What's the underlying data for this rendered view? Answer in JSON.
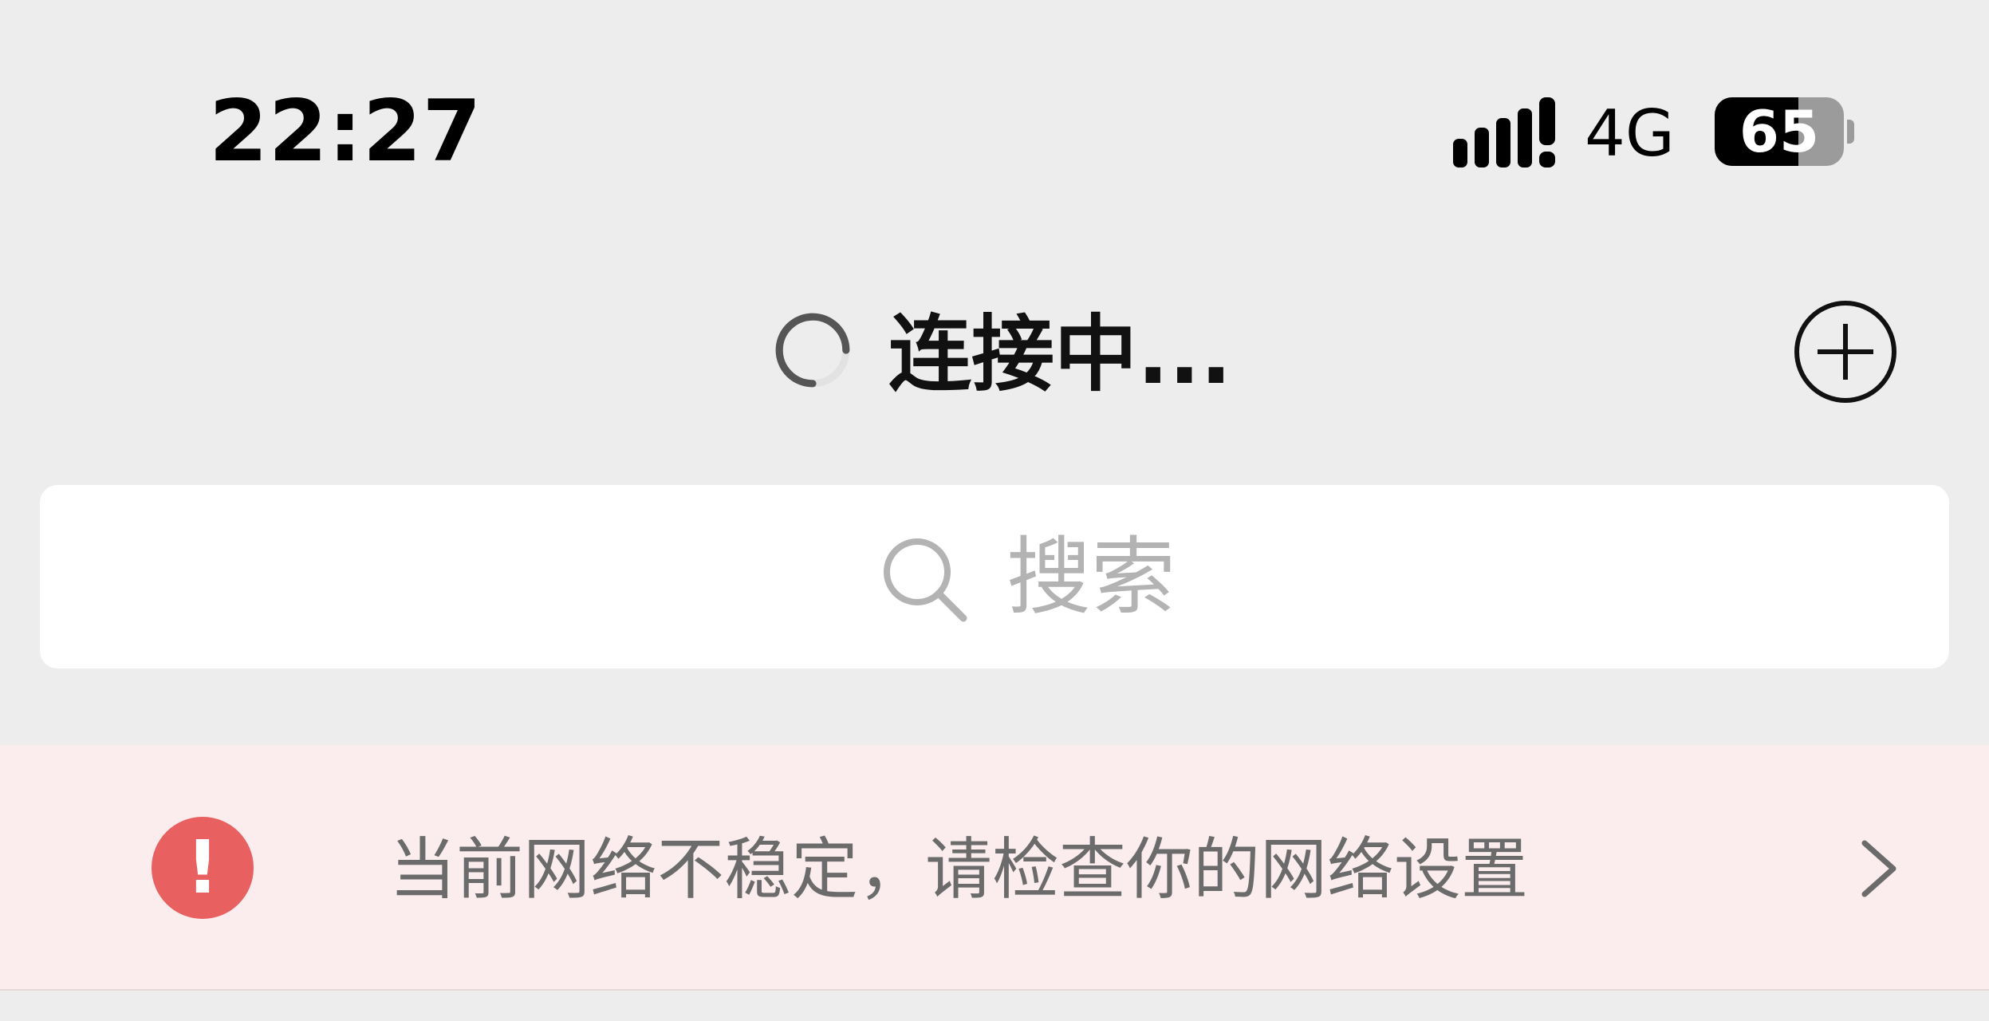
{
  "status_bar": {
    "time": "22:27",
    "network_type": "4G",
    "battery_level": "65",
    "battery_fraction": 0.65,
    "icons": [
      "signal-icon",
      "battery-icon"
    ]
  },
  "nav_bar": {
    "title": "连接中...",
    "icons": [
      "spinner-icon",
      "add-icon"
    ]
  },
  "search": {
    "placeholder": "搜索",
    "icon": "search-icon"
  },
  "warning_banner": {
    "message": "当前网络不稳定，请检查你的网络设置",
    "alert_mark": "!",
    "alert_color": "#e8605f",
    "background_color": "#fbeced",
    "icons": [
      "alert-icon",
      "chevron-right-icon"
    ]
  }
}
